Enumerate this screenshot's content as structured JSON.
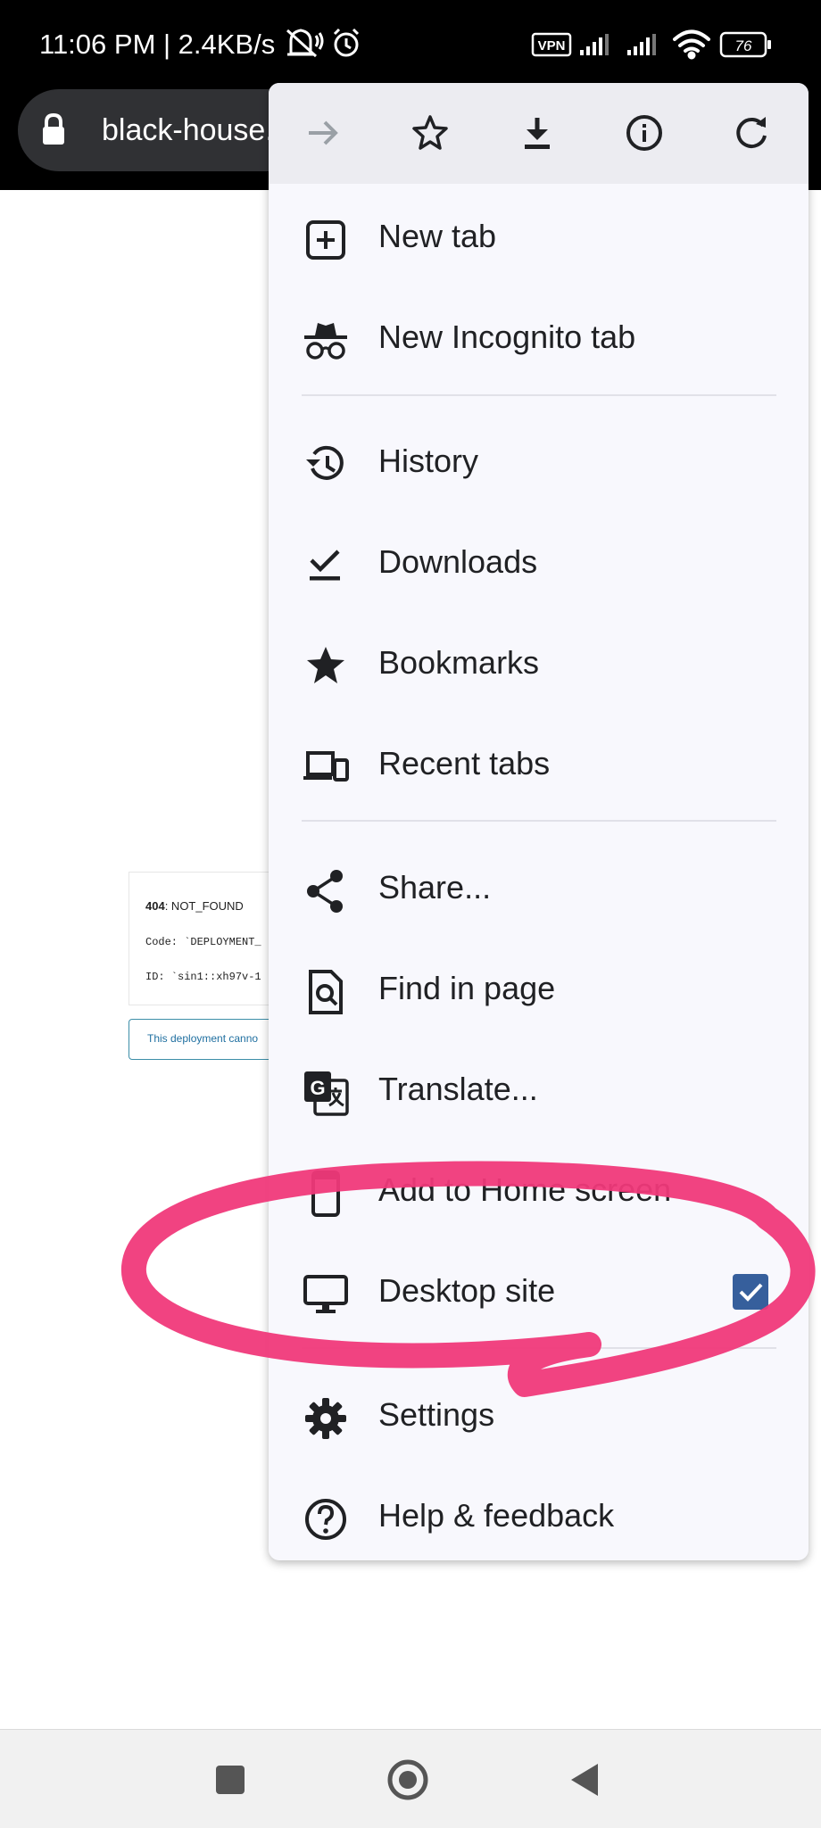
{
  "status_bar": {
    "time_and_speed": "11:06 PM | 2.4KB/s",
    "vpn_label": "VPN",
    "battery": "76"
  },
  "toolbar": {
    "url": "black-house."
  },
  "page": {
    "error_code": "404",
    "error_name": ": NOT_FOUND",
    "code_line": "Code: `DEPLOYMENT_",
    "id_line": "ID: `sin1::xh97v-1",
    "notice": "This deployment canno"
  },
  "menu": {
    "actions": [
      "forward-icon",
      "bookmark-star-icon",
      "download-icon",
      "info-icon",
      "reload-icon"
    ],
    "items": [
      {
        "label": "New tab",
        "icon": "plus-box-icon"
      },
      {
        "label": "New Incognito tab",
        "icon": "incognito-icon"
      },
      {
        "label": "History",
        "icon": "history-icon"
      },
      {
        "label": "Downloads",
        "icon": "downloads-icon"
      },
      {
        "label": "Bookmarks",
        "icon": "star-icon"
      },
      {
        "label": "Recent tabs",
        "icon": "devices-icon"
      },
      {
        "label": "Share...",
        "icon": "share-icon"
      },
      {
        "label": "Find in page",
        "icon": "find-in-page-icon"
      },
      {
        "label": "Translate...",
        "icon": "translate-icon"
      },
      {
        "label": "Add to Home screen",
        "icon": "add-to-home-icon"
      },
      {
        "label": "Desktop site",
        "icon": "monitor-icon",
        "checked": true
      },
      {
        "label": "Settings",
        "icon": "gear-icon"
      },
      {
        "label": "Help & feedback",
        "icon": "help-icon"
      }
    ]
  },
  "colors": {
    "annotation_stroke": "#f0397a",
    "checkbox": "#365f9c",
    "menu_background": "#f8f8fd"
  }
}
